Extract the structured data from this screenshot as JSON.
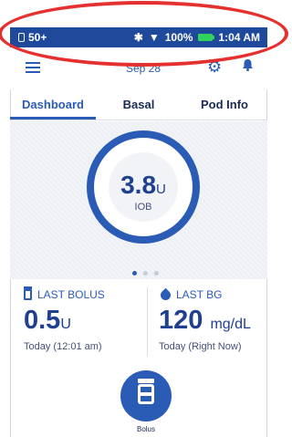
{
  "status_bar": {
    "reservoir": "50+",
    "battery_percent": "100%",
    "time": "1:04 AM"
  },
  "header": {
    "date": "Sep 28"
  },
  "tabs": [
    {
      "label": "Dashboard",
      "active": true
    },
    {
      "label": "Basal",
      "active": false
    },
    {
      "label": "Pod Info",
      "active": false
    }
  ],
  "iob": {
    "value": "3.8",
    "unit": "U",
    "label": "IOB"
  },
  "pager": {
    "pages": 3,
    "current": 1
  },
  "last_bolus": {
    "title": "LAST BOLUS",
    "value": "0.5",
    "unit": "U",
    "time": "Today (12:01 am)"
  },
  "last_bg": {
    "title": "LAST BG",
    "value": "120",
    "unit": "mg/dL",
    "time": "Today (Right Now)"
  },
  "bolus_button": {
    "label": "Bolus"
  },
  "colors": {
    "primary": "#2a5bb5",
    "status_bar": "#1f4a9c",
    "highlight_ellipse": "#e53030",
    "battery": "#2fd35e"
  }
}
